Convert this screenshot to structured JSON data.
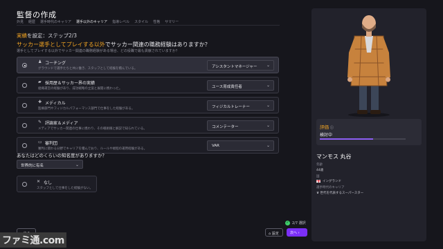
{
  "header": {
    "title": "監督の作成",
    "breadcrumb": [
      "外見",
      "経歴",
      "選手時代のキャリア",
      "選手以外のキャリア",
      "指導レベル",
      "スタイル",
      "性格",
      "サマリー"
    ],
    "breadcrumb_active_index": 3
  },
  "step": {
    "label_accent": "実績",
    "label_rest": "を設定：ステップ2/3"
  },
  "question": {
    "before": "サッカー選手としてプレイする",
    "accent": "以外",
    "after": "でサッカー関連の職務経験はありますか？",
    "hint": "選手としてプレイする以外でサッカー関連の職務経験がある場合、どの役職で最も貢献されていますか？"
  },
  "options": [
    {
      "icon": "♟",
      "icon_name": "whistle-icon",
      "title": "コーチング",
      "desc": "グラウンドで選手たちと共に働き、スタッフとして経験を積んでいる。",
      "value": "アシスタントマネージャー",
      "selected": true
    },
    {
      "icon": "▰",
      "icon_name": "briefcase-icon",
      "title": "採用歴＆サッカー界の実績",
      "desc": "組織運営の経験があり、成功戦略の立案と展開に携わった。",
      "value": "ユース育成責任者",
      "selected": false
    },
    {
      "icon": "✚",
      "icon_name": "medical-icon",
      "title": "メディカル",
      "desc": "医療部門やフィジカルパフォーマンス部門で仕事をした経験がある。",
      "value": "フィジカルトレーナー",
      "selected": false
    },
    {
      "icon": "✎",
      "icon_name": "pen-icon",
      "title": "評論家＆メディア",
      "desc": "メディアでサッカー関連の仕事に携わり、その戦術眼と解説で知られている。",
      "value": "コメンテーター",
      "selected": false
    },
    {
      "icon": "▭",
      "icon_name": "monitor-icon",
      "title": "審判団",
      "desc": "審判に関わる分野でキャリアを積んでおり、ルールや規程の運用経験がある。",
      "value": "VAR",
      "selected": false
    }
  ],
  "fame": {
    "label": "あなたはどのくらいの知名度がありますか？",
    "value": "世界的に有名"
  },
  "none_option": {
    "icon": "✕",
    "title": "なし",
    "desc": "スタッフとして仕事をした経験がない。"
  },
  "footer": {
    "back_label": "戻る",
    "selection_count": "2/7 選択",
    "settings_label": "設定",
    "next_label": "次へ",
    "watermark": "ファミ通.com"
  },
  "panel": {
    "rating_label": "評価",
    "rating_status": "検討中",
    "rating_fraction": 0.62,
    "player_name": "マンモス 丸谷",
    "age_label": "年齢",
    "age_value": "44歳",
    "nation_label": "国",
    "nation_value": "イングランド",
    "career_label": "選手時代のキャリア",
    "career_value": "世代を代表するスーパースター"
  },
  "colors": {
    "accent": "#f5a623",
    "primary": "#7b2ff7",
    "rating_fill": "#8e5ff5",
    "check": "#3ecf6a"
  }
}
